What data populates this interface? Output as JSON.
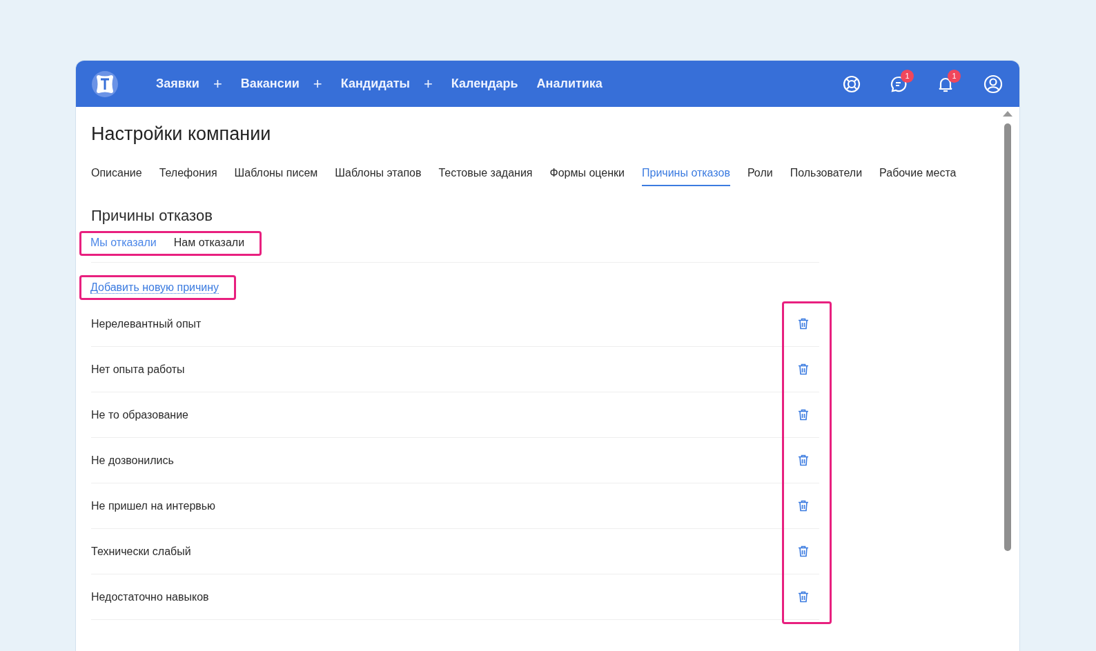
{
  "nav": {
    "items": [
      {
        "label": "Заявки",
        "plus": "+"
      },
      {
        "label": "Вакансии",
        "plus": "+"
      },
      {
        "label": "Кандидаты",
        "plus": "+"
      },
      {
        "label": "Календарь"
      },
      {
        "label": "Аналитика"
      }
    ],
    "icons": [
      {
        "kind": "support"
      },
      {
        "kind": "chat",
        "badge": "1"
      },
      {
        "kind": "bell",
        "badge": "1"
      },
      {
        "kind": "profile"
      }
    ]
  },
  "page_title": "Настройки компании",
  "tabs": [
    {
      "label": "Описание",
      "selected": false
    },
    {
      "label": "Телефония",
      "selected": false
    },
    {
      "label": "Шаблоны писем",
      "selected": false
    },
    {
      "label": "Шаблоны этапов",
      "selected": false
    },
    {
      "label": "Тестовые задания",
      "selected": false
    },
    {
      "label": "Формы оценки",
      "selected": false
    },
    {
      "label": "Причины отказов",
      "selected": true
    },
    {
      "label": "Роли",
      "selected": false
    },
    {
      "label": "Пользователи",
      "selected": false
    },
    {
      "label": "Рабочие места",
      "selected": false
    }
  ],
  "section_title": "Причины отказов",
  "subtabs": [
    {
      "label": "Мы отказали",
      "selected": true
    },
    {
      "label": "Нам отказали",
      "selected": false
    }
  ],
  "add_link": "Добавить новую причину",
  "reasons": [
    "Нерелевантный опыт",
    "Нет опыта работы",
    "Не то образование",
    "Не дозвонились",
    "Не пришел на интервью",
    "Технически слабый",
    "Недостаточно навыков"
  ]
}
